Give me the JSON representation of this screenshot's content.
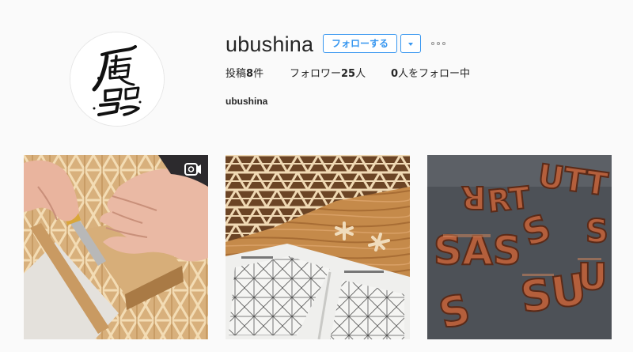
{
  "profile": {
    "username": "ubushina",
    "follow_label": "フォローする",
    "dropdown_icon": "chevron-down-icon",
    "options_icon": "more-options-icon",
    "full_name": "ubushina",
    "avatar_icon": "calligraphy-logo"
  },
  "stats": {
    "posts_prefix": "投稿",
    "posts_count": "8",
    "posts_suffix": "件",
    "followers_prefix": "フォロワー",
    "followers_count": "25",
    "followers_suffix": "人",
    "following_count": "0",
    "following_suffix": "人をフォロー中"
  },
  "posts": [
    {
      "type": "video",
      "subject": "kumiko-woodwork-hands",
      "badge_icon": "video-camera-icon"
    },
    {
      "type": "image",
      "subject": "kumiko-pattern-book"
    },
    {
      "type": "image",
      "subject": "copper-letters"
    }
  ],
  "colors": {
    "accent": "#3897f0",
    "background": "#fafafa",
    "text": "#262626"
  }
}
